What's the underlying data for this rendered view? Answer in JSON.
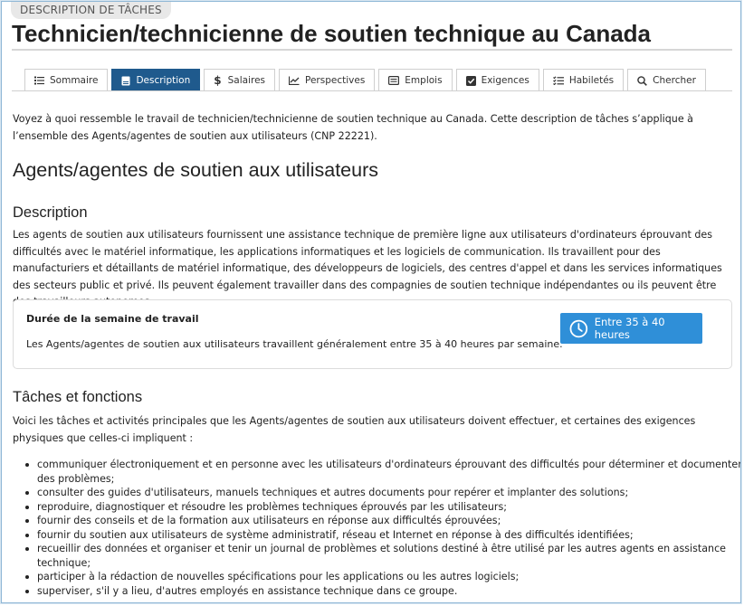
{
  "pill_label": "DESCRIPTION DE TÂCHES",
  "page_title": "Technicien/technicienne de soutien technique au Canada",
  "tabs": [
    {
      "label": "Sommaire",
      "icon": "list-icon",
      "active": false
    },
    {
      "label": "Description",
      "icon": "document-icon",
      "active": true
    },
    {
      "label": "Salaires",
      "icon": "dollar-icon",
      "active": false
    },
    {
      "label": "Perspectives",
      "icon": "trend-chart-icon",
      "active": false
    },
    {
      "label": "Emplois",
      "icon": "job-listing-icon",
      "active": false
    },
    {
      "label": "Exigences",
      "icon": "checkbox-icon",
      "active": false
    },
    {
      "label": "Habiletés",
      "icon": "checklist-icon",
      "active": false
    },
    {
      "label": "Chercher",
      "icon": "search-icon",
      "active": false
    }
  ],
  "intro": "Voyez à quoi ressemble le travail de technicien/technicienne de soutien technique au Canada. Cette description de tâches s’applique à l’ensemble des Agents/agentes de soutien aux utilisateurs (CNP 22221).",
  "occupation_heading": "Agents/agentes de soutien aux utilisateurs",
  "description_heading": "Description",
  "description_text": "Les agents de soutien aux utilisateurs fournissent une assistance technique de première ligne aux utilisateurs d'ordinateurs éprouvant des difficultés avec le matériel informatique, les applications informatiques et les logiciels de communication. Ils travaillent pour des manufacturiers et détaillants de matériel informatique, des développeurs de logiciels, des centres d'appel et dans les services informatiques des secteurs public et privé. Ils peuvent également travailler dans des compagnies de soutien technique indépendantes ou ils peuvent être des travailleurs autonomes.",
  "workweek": {
    "title": "Durée de la semaine de travail",
    "text": "Les Agents/agentes de soutien aux utilisateurs travaillent généralement entre 35 à 40 heures par semaine.",
    "button_label": "Entre 35 à 40 heures",
    "button_icon": "clock-icon"
  },
  "duties_heading": "Tâches et fonctions",
  "duties_intro": "Voici les tâches et activités principales que les Agents/agentes de soutien aux utilisateurs doivent effectuer, et certaines des exigences physiques que celles-ci impliquent :",
  "duties": [
    "communiquer électroniquement et en personne avec les utilisateurs d'ordinateurs éprouvant des difficultés pour déterminer et documenter des problèmes;",
    "consulter des guides d'utilisateurs, manuels techniques et autres documents pour repérer et implanter des solutions;",
    "reproduire, diagnostiquer et résoudre les problèmes techniques éprouvés par les utilisateurs;",
    "fournir des conseils et de la formation aux utilisateurs en réponse aux difficultés éprouvées;",
    "fournir du soutien aux utilisateurs de système administratif, réseau et Internet en réponse à des difficultés identifiées;",
    "recueillir des données et organiser et tenir un journal de problèmes et solutions destiné à être utilisé par les autres agents en assistance technique;",
    "participer à la rédaction de nouvelles spécifications pour les applications ou les autres logiciels;",
    "superviser, s'il y a lieu, d'autres employés en assistance technique dans ce groupe."
  ],
  "colors": {
    "active_tab": "#1f5a8d",
    "hours_button": "#2f8fd8"
  }
}
